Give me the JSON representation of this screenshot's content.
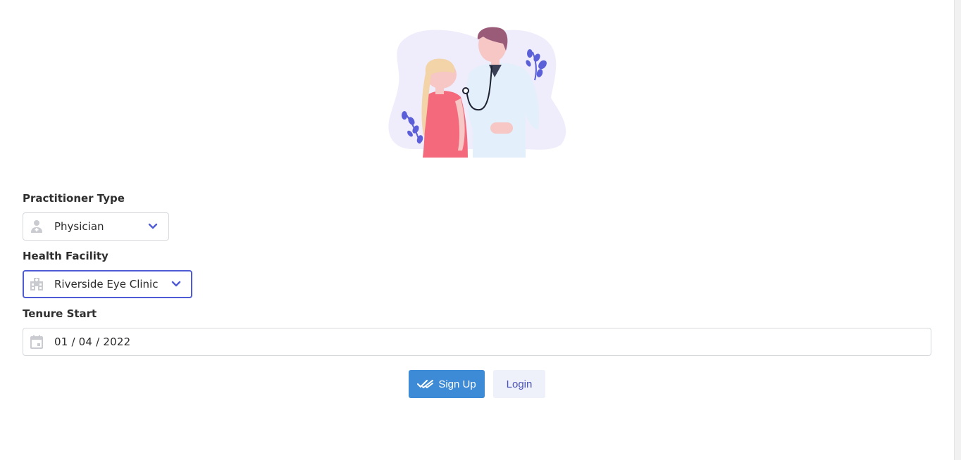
{
  "form": {
    "practitioner_type": {
      "label": "Practitioner Type",
      "value": "Physician"
    },
    "health_facility": {
      "label": "Health Facility",
      "value": "Riverside Eye Clinic"
    },
    "tenure_start": {
      "label": "Tenure Start",
      "value": "01 / 04 / 2022"
    }
  },
  "actions": {
    "signup_label": "Sign Up",
    "login_label": "Login"
  },
  "colors": {
    "accent": "#4f5bd5",
    "primary_button": "#3d8bd6",
    "secondary_button_bg": "#eef0fa",
    "illustration_blob": "#efedfb",
    "dress": "#f46a7c"
  },
  "icons": {
    "practitioner": "user-doctor-icon",
    "facility": "hospital-building-icon",
    "date": "calendar-icon",
    "dropdown": "chevron-down-icon",
    "signup": "double-check-icon"
  }
}
